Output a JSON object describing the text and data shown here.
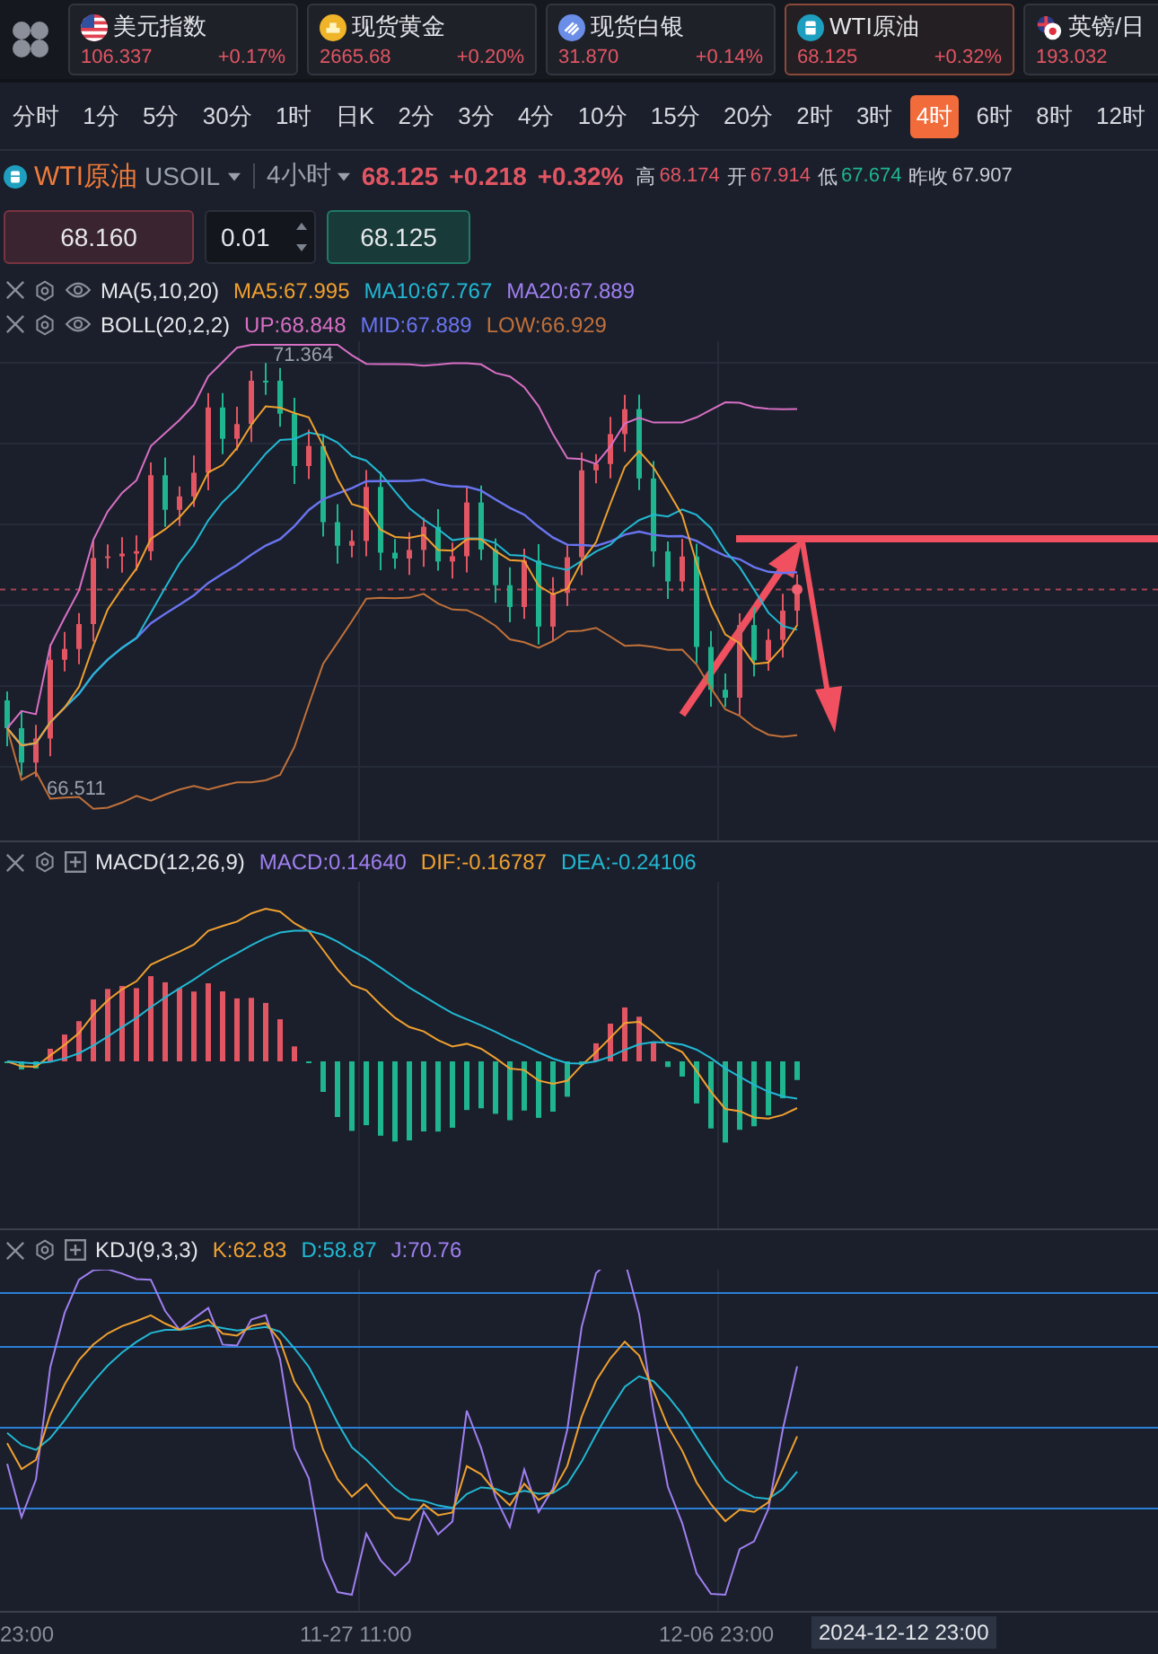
{
  "tickers": [
    {
      "kind": "usd",
      "name": "美元指数",
      "value": "106.337",
      "change": "+0.17%",
      "selected": false
    },
    {
      "kind": "gold",
      "name": "现货黄金",
      "value": "2665.68",
      "change": "+0.20%",
      "selected": false
    },
    {
      "kind": "silver",
      "name": "现货白银",
      "value": "31.870",
      "change": "+0.14%",
      "selected": false
    },
    {
      "kind": "oil",
      "name": "WTI原油",
      "value": "68.125",
      "change": "+0.32%",
      "selected": true
    },
    {
      "kind": "gbpjpy",
      "name": "英镑/日",
      "value": "193.032",
      "selected": false
    }
  ],
  "timeframes": [
    {
      "label": "分时",
      "selected": false
    },
    {
      "label": "1分",
      "selected": false
    },
    {
      "label": "5分",
      "selected": false
    },
    {
      "label": "30分",
      "selected": false
    },
    {
      "label": "1时",
      "selected": false
    },
    {
      "label": "日K",
      "selected": false
    },
    {
      "label": "2分",
      "selected": false
    },
    {
      "label": "3分",
      "selected": false
    },
    {
      "label": "4分",
      "selected": false
    },
    {
      "label": "10分",
      "selected": false
    },
    {
      "label": "15分",
      "selected": false
    },
    {
      "label": "20分",
      "selected": false
    },
    {
      "label": "2时",
      "selected": false
    },
    {
      "label": "3时",
      "selected": false
    },
    {
      "label": "4时",
      "selected": true
    },
    {
      "label": "6时",
      "selected": false
    },
    {
      "label": "8时",
      "selected": false
    },
    {
      "label": "12时",
      "selected": false
    }
  ],
  "symbol": {
    "name": "WTI原油",
    "code": "USOIL",
    "period": "4小时",
    "price": "68.125",
    "change": "+0.218",
    "change_pct": "+0.32%",
    "stats": [
      {
        "label": "高",
        "value": "68.174",
        "color": "#e25563"
      },
      {
        "label": "开",
        "value": "67.914",
        "color": "#e25563"
      },
      {
        "label": "低",
        "value": "67.674",
        "color": "#1fb58f"
      },
      {
        "label": "昨收",
        "value": "67.907",
        "color": "#c9ccd3"
      }
    ]
  },
  "trade": {
    "sell": "68.160",
    "lots": "0.01",
    "buy": "68.125"
  },
  "main_chart": {
    "indicators": [
      {
        "kind": "overlay",
        "name": "MA(5,10,20)",
        "values": [
          {
            "text": "MA5:67.995",
            "color": "#f0a030"
          },
          {
            "text": "MA10:67.767",
            "color": "#22b8d3"
          },
          {
            "text": "MA20:67.889",
            "color": "#a07ff0"
          }
        ]
      },
      {
        "kind": "overlay",
        "name": "BOLL(20,2,2)",
        "values": [
          {
            "text": "UP:68.848",
            "color": "#d86fc4"
          },
          {
            "text": "MID:67.889",
            "color": "#6a74f0"
          },
          {
            "text": "LOW:66.929",
            "color": "#c0703a"
          }
        ]
      }
    ],
    "high_label": "71.364",
    "low_label": "66.511"
  },
  "macd": {
    "kind": "pane",
    "name": "MACD(12,26,9)",
    "values": [
      {
        "text": "MACD:0.14640",
        "color": "#a07ff0"
      },
      {
        "text": "DIF:-0.16787",
        "color": "#f0a030"
      },
      {
        "text": "DEA:-0.24106",
        "color": "#22b8d3"
      }
    ]
  },
  "kdj": {
    "kind": "pane",
    "name": "KDJ(9,3,3)",
    "values": [
      {
        "text": "K:62.83",
        "color": "#f0a030"
      },
      {
        "text": "D:58.87",
        "color": "#22b8d3"
      },
      {
        "text": "J:70.76",
        "color": "#a07ff0"
      }
    ]
  },
  "time_axis": {
    "labels": [
      "23:00",
      "11-27 11:00",
      "12-06 23:00"
    ],
    "cursor": "2024-12-12 23:00"
  }
}
